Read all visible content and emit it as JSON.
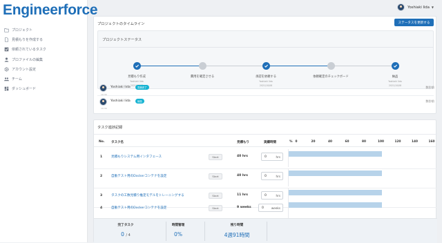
{
  "app": {
    "logo": "Engineerforce"
  },
  "sidebar": {
    "items": [
      {
        "label": "プロジェクト",
        "icon": "folder-icon"
      },
      {
        "label": "見積もりを作成する",
        "icon": "document-icon"
      },
      {
        "label": "依頼されているタスク",
        "icon": "checkbox-icon"
      },
      {
        "label": "プロファイルの編集",
        "icon": "user-icon"
      },
      {
        "label": "アカウント設定",
        "icon": "gear-icon"
      },
      {
        "label": "チーム",
        "icon": "team-icon"
      },
      {
        "label": "ダッシュボード",
        "icon": "dashboard-icon"
      }
    ]
  },
  "header": {
    "user_name": "Yoshiaki Iida"
  },
  "timeline": {
    "title": "プロジェクトのタイムライン",
    "update_button": "ステータスを更新する",
    "status": {
      "title": "プロジェクトステータス",
      "steps": [
        {
          "label": "見積もり作成",
          "sub1": "Yoshiaki Iida",
          "sub2": "2021/10/08",
          "done": true
        },
        {
          "label": "費用を確定させる",
          "sub1": "",
          "sub2": "",
          "done": false
        },
        {
          "label": "承認を依頼する",
          "sub1": "Yoshiaki Iida",
          "sub2": "2021/10/08",
          "done": true
        },
        {
          "label": "依頼確定のチェックボード",
          "sub1": "",
          "sub2": "",
          "done": false
        },
        {
          "label": "納品",
          "sub1": "Yoshiaki Iida",
          "sub2": "2021/10/08",
          "done": true
        }
      ]
    },
    "entries": [
      {
        "name": "Yoshiaki Iida",
        "badge": "見積完了",
        "time": "10:30",
        "ago": "数秒前"
      },
      {
        "name": "Yoshiaki Iida",
        "badge": "納品",
        "time": "10:30",
        "ago": "数秒前"
      }
    ]
  },
  "tasks": {
    "title": "タスク進捗記録",
    "headers": {
      "no": "No.",
      "name": "タスク名",
      "estimate": "見積もり",
      "actual": "実績時間",
      "percent": "%"
    },
    "axis": [
      0,
      20,
      40,
      60,
      80,
      100,
      120,
      140,
      160
    ],
    "start_label": "Start",
    "rows": [
      {
        "no": "1",
        "name": "見積もりシステム用インタフェース",
        "estimate": "40 hrs",
        "actual": "0",
        "unit": "hrs",
        "progress": 100
      },
      {
        "no": "2",
        "name": "自動テスト用のDockerコンテナを設定",
        "estimate": "40 hrs",
        "actual": "0",
        "unit": "hrs",
        "progress": 100
      },
      {
        "no": "3",
        "name": "タスクの工数見積り推定モデルをトレーニングする",
        "estimate": "11 hrs",
        "actual": "0",
        "unit": "hrs",
        "progress": 100
      },
      {
        "no": "4",
        "name": "自動テスト用のDockerコンテナを設定",
        "estimate": "9 weeks",
        "actual": "0",
        "unit": "weeks",
        "progress": 100
      }
    ],
    "summary": {
      "completed_label": "完了タスク",
      "completed_value": "0",
      "completed_total": "/ 4",
      "time_label": "時間管理",
      "time_value": "0%",
      "remaining_label": "残り時間",
      "remaining_value": "4週91時間"
    }
  },
  "colors": {
    "accent": "#1f6fb8",
    "badge": "#17b3d2",
    "bar": "#b7d3ea"
  }
}
